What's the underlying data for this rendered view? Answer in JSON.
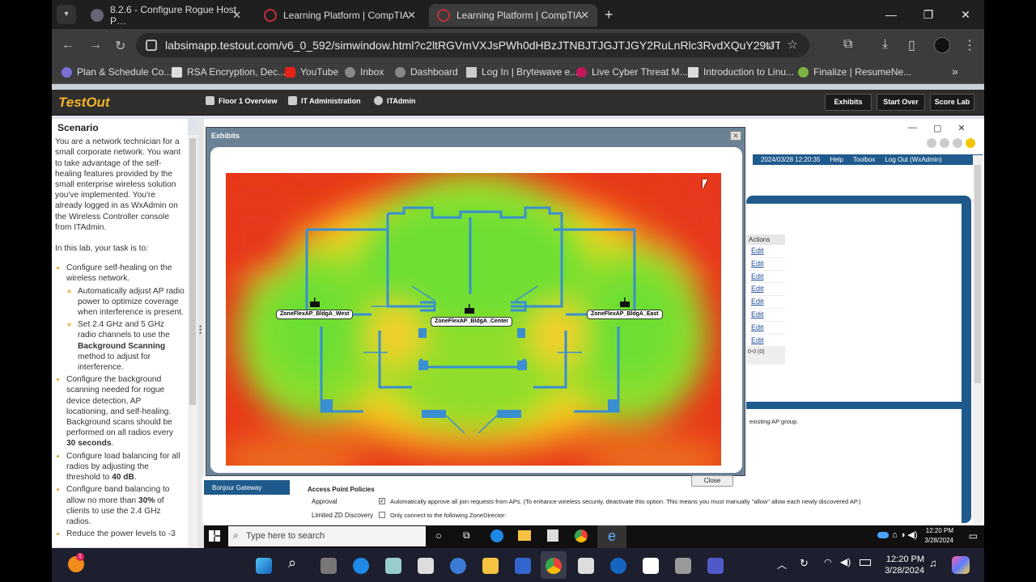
{
  "browser": {
    "tabs": [
      {
        "label": "8.2.6 - Configure Rogue Host P…"
      },
      {
        "label": "Learning Platform | CompTIA"
      },
      {
        "label": "Learning Platform | CompTIA"
      }
    ],
    "url": "labsimapp.testout.com/v6_0_592/simwindow.html?c2ltRGVmVXJsPWh0dHBzJTNBJTJGJTJGY2RuLnRlc3RvdXQuY29tJTJGX3ZlcnNpb25fN...",
    "bookmarks": [
      "Plan & Schedule Co...",
      "RSA Encryption, Dec...",
      "YouTube",
      "Inbox",
      "Dashboard",
      "Log In | Brytewave e...",
      "Live Cyber Threat M...",
      "Introduction to Linu...",
      "Finalize | ResumeNe..."
    ]
  },
  "testout": {
    "logo": "TestOut",
    "crumbs": [
      "Floor 1 Overview",
      "IT Administration",
      "ITAdmin"
    ],
    "buttons": [
      "Exhibits",
      "Start Over",
      "Score Lab"
    ]
  },
  "scenario": {
    "title": "Scenario",
    "intro": "You are a network technician for a small corporate network. You want to take advantage of the self-healing features provided by the small enterprise wireless solution you've implemented. You're already logged in as WxAdmin on the Wireless Controller console from ITAdmin.",
    "task": "In this lab, your task is to:",
    "i1": "Configure self-healing on the wireless network.",
    "i1a": "Automatically adjust AP radio power to optimize coverage when interference is present.",
    "i1b_pre": "Set 2.4 GHz and 5 GHz radio channels to use the ",
    "i1b_bold": "Background Scanning",
    "i1b_post": " method to adjust for interference.",
    "i2_pre": "Configure the background scanning needed for rogue device detection, AP locationing, and self-healing. Background scans should be performed on all radios every ",
    "i2_bold": "30 seconds",
    "i2_post": ".",
    "i3_pre": "Configure load balancing for all radios by adjusting the threshold to ",
    "i3_bold": "40 dB",
    "i3_post": ".",
    "i4_pre": "Configure band balancing to allow no more than ",
    "i4_bold": "30%",
    "i4_post": " of clients to use the 2.4 GHz radios.",
    "i5": "Reduce the power levels to -3"
  },
  "sim": {
    "topbar": [
      "2024/03/28 12:20:35",
      "Help",
      "Toolbox",
      "Log Out (WxAdmin)"
    ],
    "actions_header": "Actions",
    "edit": [
      "Edit",
      "Edit",
      "Edit",
      "Edit",
      "Edit",
      "Edit",
      "Edit",
      "Edit"
    ],
    "page_count": "0-0 (0)",
    "ap_group_text": "existing AP group.",
    "bonjour": "Bonjour Gateway",
    "policies_title": "Access Point Policies",
    "approval_label": "Approval",
    "approval_text": "Automatically approve all join requests from APs. (To enhance wireless security, deactivate this option. This means you must manually \"allow\" allow each newly discovered AP.)",
    "limited_label": "Limited ZD Discovery",
    "limited_text": "Only connect to the following ZoneDirector:"
  },
  "exhibit": {
    "title": "Exhibits",
    "close": "Close",
    "aps": [
      "ZoneFlexAP_BldgA_West",
      "ZoneFlexAP_BldgA_Center",
      "ZoneFlexAP_BldgA_East"
    ]
  },
  "taskbar": {
    "search": "Type here to search",
    "inner_time": "12:20 PM",
    "inner_date": "3/28/2024",
    "time": "12:20 PM",
    "date": "3/28/2024"
  }
}
